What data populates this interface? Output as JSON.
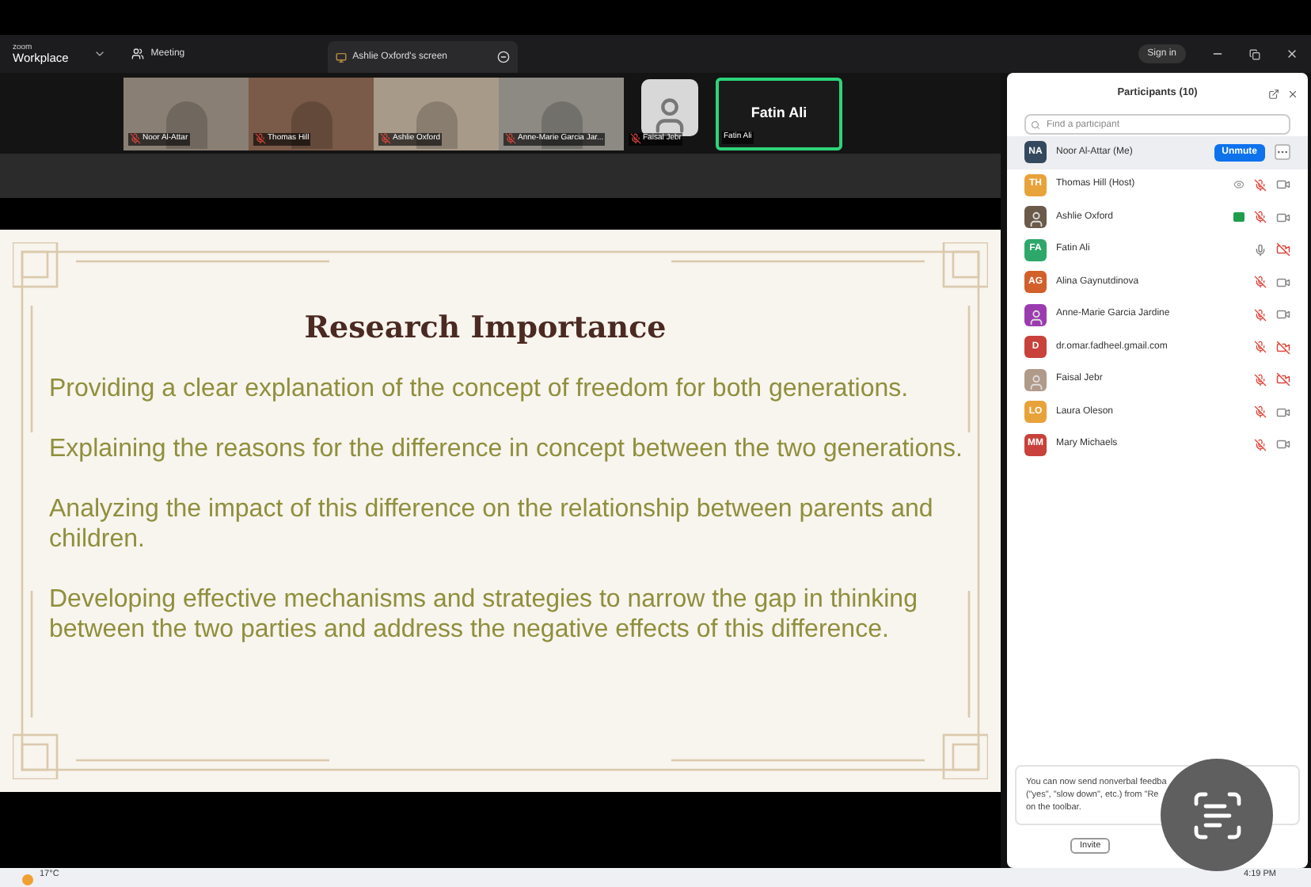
{
  "title_bar": {
    "logo_small": "zoom",
    "logo": "Workplace",
    "meeting": "Meeting",
    "share_label": "Ashlie Oxford's screen",
    "sign_in": "Sign in"
  },
  "video_strip": [
    {
      "name": "Noor Al-Attar",
      "kind": "video",
      "muted": true,
      "selected": false,
      "color": "#8a7f74"
    },
    {
      "name": "Thomas Hill",
      "kind": "video",
      "muted": true,
      "selected": false,
      "color": "#7a5a48"
    },
    {
      "name": "Ashlie Oxford",
      "kind": "video",
      "muted": true,
      "selected": false,
      "color": "#a89a88"
    },
    {
      "name": "Anne-Marie Garcia Jar...",
      "kind": "video",
      "muted": true,
      "selected": false,
      "color": "#8d8a84"
    },
    {
      "name": "Faisal Jebr",
      "kind": "photo",
      "muted": true,
      "selected": false,
      "color": "#d8d8d8"
    },
    {
      "name": "Fatin Ali",
      "label": "Fatin Ali",
      "kind": "name_card",
      "muted": false,
      "selected": true,
      "color": "#1a1a1a"
    }
  ],
  "slide": {
    "title": "Research Importance",
    "points": [
      "Providing a clear explanation of the concept of freedom for both generations.",
      "Explaining the reasons for the difference in concept between the two generations.",
      "Analyzing the impact of this difference on the relationship between parents and children.",
      "Developing effective mechanisms and strategies to narrow the gap in thinking between the two parties and address the negative effects of this difference."
    ]
  },
  "participants_panel": {
    "title": "Participants (10)",
    "search": {
      "placeholder": "Find a participant"
    },
    "participants": [
      {
        "initials": "NA",
        "name": "Noor Al-Attar (Me)",
        "kind": "initials",
        "color": "#34495e",
        "selected": true,
        "muted": true,
        "button": "Unmute"
      },
      {
        "initials": "TH",
        "name": "Thomas Hill (Host)",
        "kind": "initials",
        "color": "#e8a23a",
        "selected": false,
        "muted": true,
        "video_off": false,
        "eye": true
      },
      {
        "name": "Ashlie Oxford",
        "kind": "photo",
        "color": "#6b5a4a",
        "selected": false,
        "muted": true,
        "video_off": false,
        "badge": true
      },
      {
        "initials": "FA",
        "name": "Fatin Ali",
        "kind": "initials",
        "color": "#2ea86a",
        "selected": false,
        "muted": false,
        "video_off": true
      },
      {
        "initials": "AG",
        "name": "Alina Gaynutdinova",
        "kind": "initials",
        "color": "#d2602a",
        "selected": false,
        "muted": true,
        "video_off": false
      },
      {
        "name": "Anne-Marie Garcia Jardine",
        "kind": "photo",
        "color": "#9b3bb0",
        "selected": false,
        "muted": true,
        "video_off": false
      },
      {
        "initials": "D",
        "name": "dr.omar.fadheel.gmail.com",
        "kind": "initials",
        "color": "#c8413a",
        "selected": false,
        "muted": true,
        "video_off": true
      },
      {
        "name": "Faisal Jebr",
        "kind": "photo",
        "color": "#b09a8a",
        "selected": false,
        "muted": true,
        "video_off": true
      },
      {
        "initials": "LO",
        "name": "Laura Oleson",
        "kind": "initials",
        "color": "#e8a23a",
        "selected": false,
        "muted": true,
        "video_off": false
      },
      {
        "initials": "MM",
        "name": "Mary Michaels",
        "kind": "initials",
        "color": "#c8413a",
        "selected": false,
        "muted": true,
        "video_off": false
      }
    ],
    "tip_lines": [
      "You can now send nonverbal feedba",
      "(\"yes\", \"slow down\", etc.) from \"Re",
      "on the toolbar."
    ],
    "invite": "Invite"
  },
  "taskbar": {
    "weather": "17°C",
    "clock": "4:19 PM"
  }
}
